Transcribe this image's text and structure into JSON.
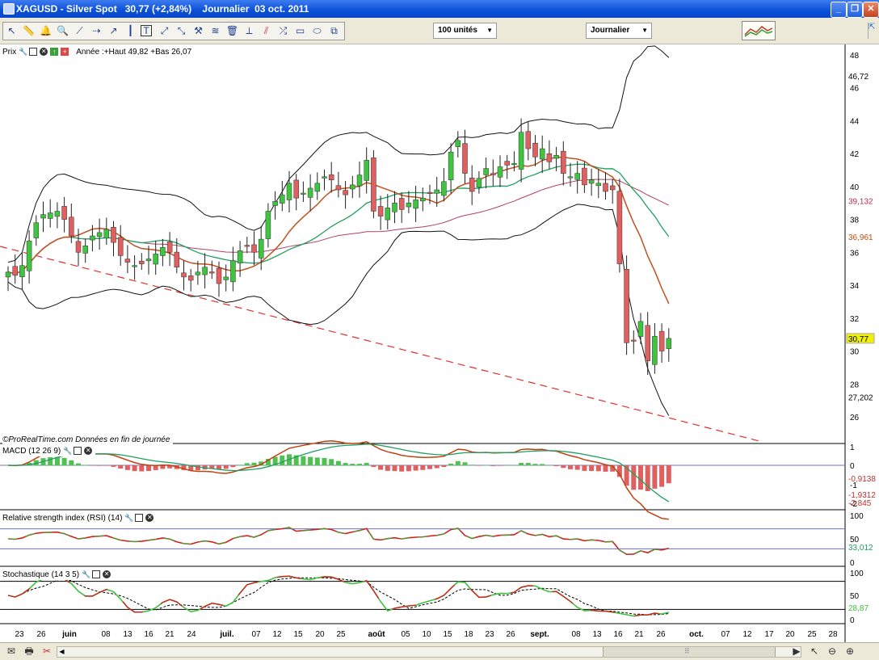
{
  "window": {
    "title": "XAGUSD - Silver Spot   30,77 (+2,84%)    Journalier  03 oct. 2011",
    "minimize_glyph": "_",
    "restore_glyph": "❐",
    "close_glyph": "✕"
  },
  "toolbar": {
    "tools": [
      {
        "name": "pointer-icon",
        "glyph": "↖"
      },
      {
        "name": "ruler-icon",
        "glyph": "📏"
      },
      {
        "name": "alarm-icon",
        "glyph": "🔔"
      },
      {
        "name": "zoom-icon",
        "glyph": "🔍"
      },
      {
        "name": "line-icon",
        "glyph": "⟋"
      },
      {
        "name": "hline-icon",
        "glyph": "⇢"
      },
      {
        "name": "trendline-icon",
        "glyph": "↗"
      },
      {
        "name": "vline-icon",
        "glyph": "┃"
      },
      {
        "name": "text-icon",
        "glyph": "T"
      },
      {
        "name": "arrows-icon",
        "glyph": "⤢"
      },
      {
        "name": "cross-icon",
        "glyph": "⤡"
      },
      {
        "name": "tools-icon",
        "glyph": "⚒"
      },
      {
        "name": "fibo-icon",
        "glyph": "≋"
      },
      {
        "name": "trash-icon",
        "glyph": "🗑"
      },
      {
        "name": "fan-icon",
        "glyph": "⟂"
      },
      {
        "name": "pattern-icon",
        "glyph": "⫽"
      },
      {
        "name": "channel-icon",
        "glyph": "⤮"
      },
      {
        "name": "rectangle-icon",
        "glyph": "▭"
      },
      {
        "name": "ellipse-icon",
        "glyph": "⬭"
      },
      {
        "name": "copy-icon",
        "glyph": "⧉"
      }
    ],
    "units_select": "100 unités",
    "period_select": "Journalier",
    "dropdown_arrow": "▼"
  },
  "price_panel": {
    "label": "Prix",
    "info": "Année :+Haut 49,82 +Bas 26,07",
    "y_ticks": [
      "48",
      "46",
      "44",
      "42",
      "40",
      "38",
      "36",
      "34",
      "32",
      "30",
      "28",
      "26"
    ],
    "markers": [
      {
        "text": "46,72",
        "color": "#000000",
        "bg": "#ffffff"
      },
      {
        "text": "39,132",
        "color": "#b03050",
        "bg": "#ffffff"
      },
      {
        "text": "36,961",
        "color": "#c05010",
        "bg": "#ffffff"
      },
      {
        "text": "30,77",
        "color": "#000000",
        "bg": "#f0f000"
      },
      {
        "text": "27,202",
        "color": "#000000",
        "bg": "#ffffff"
      }
    ],
    "footer": "©ProRealTime.com  Données en fin de journée"
  },
  "macd_panel": {
    "label": "MACD (12 26 9)",
    "y_ticks": [
      "1",
      "0",
      "-1",
      "-2"
    ],
    "markers": [
      {
        "text": "-0,9138",
        "color": "#c03030"
      },
      {
        "text": "-1,9312",
        "color": "#c03030"
      },
      {
        "text": "-2,845",
        "color": "#c03030"
      }
    ]
  },
  "rsi_panel": {
    "label": "Relative strength index (RSI) (14)",
    "y_ticks": [
      "100",
      "50",
      "0"
    ],
    "markers": [
      {
        "text": "33,012",
        "color": "#20a060"
      }
    ]
  },
  "stoch_panel": {
    "label": "Stochastique (14 3 5)",
    "y_ticks": [
      "100",
      "50",
      "0"
    ],
    "markers": [
      {
        "text": "28,87",
        "color": "#40c040"
      }
    ]
  },
  "x_axis": {
    "labels": [
      {
        "t": "23",
        "b": false
      },
      {
        "t": "26",
        "b": false
      },
      {
        "t": "juin",
        "b": true
      },
      {
        "t": "08",
        "b": false
      },
      {
        "t": "13",
        "b": false
      },
      {
        "t": "16",
        "b": false
      },
      {
        "t": "21",
        "b": false
      },
      {
        "t": "24",
        "b": false
      },
      {
        "t": "juil.",
        "b": true
      },
      {
        "t": "07",
        "b": false
      },
      {
        "t": "12",
        "b": false
      },
      {
        "t": "15",
        "b": false
      },
      {
        "t": "20",
        "b": false
      },
      {
        "t": "25",
        "b": false
      },
      {
        "t": "août",
        "b": true
      },
      {
        "t": "05",
        "b": false
      },
      {
        "t": "10",
        "b": false
      },
      {
        "t": "15",
        "b": false
      },
      {
        "t": "18",
        "b": false
      },
      {
        "t": "23",
        "b": false
      },
      {
        "t": "26",
        "b": false
      },
      {
        "t": "sept.",
        "b": true
      },
      {
        "t": "08",
        "b": false
      },
      {
        "t": "13",
        "b": false
      },
      {
        "t": "16",
        "b": false
      },
      {
        "t": "21",
        "b": false
      },
      {
        "t": "26",
        "b": false
      },
      {
        "t": "oct.",
        "b": true
      },
      {
        "t": "07",
        "b": false
      },
      {
        "t": "12",
        "b": false
      },
      {
        "t": "17",
        "b": false
      },
      {
        "t": "20",
        "b": false
      },
      {
        "t": "25",
        "b": false
      },
      {
        "t": "28",
        "b": false
      }
    ]
  },
  "chart_data": {
    "type": "candlestick",
    "ylim": [
      25,
      49
    ],
    "closes": [
      34.8,
      34.6,
      35.2,
      36.7,
      37.8,
      38.3,
      38.4,
      38.5,
      38.0,
      37.0,
      36.0,
      36.4,
      37.0,
      37.2,
      37.4,
      36.6,
      35.8,
      35.4,
      35.2,
      35.3,
      35.6,
      35.9,
      36.3,
      36.0,
      35.1,
      34.5,
      34.3,
      34.8,
      35.1,
      34.8,
      34.1,
      34.5,
      35.5,
      36.1,
      36.4,
      36.0,
      36.8,
      38.5,
      39.1,
      39.5,
      40.2,
      39.3,
      39.6,
      39.9,
      40.2,
      40.6,
      40.4,
      39.8,
      39.5,
      40.1,
      40.7,
      41.6,
      38.5,
      38.2,
      38.7,
      39.0,
      38.6,
      39.0,
      39.2,
      39.3,
      39.6,
      39.8,
      40.3,
      42.1,
      42.8,
      40.8,
      39.7,
      40.5,
      41.1,
      40.7,
      41.2,
      41.3,
      41.4,
      43.3,
      42.3,
      41.8,
      42.3,
      41.5,
      41.9,
      40.8,
      40.6,
      40.8,
      40.1,
      40.4,
      40.2,
      39.7,
      39.8,
      35.3,
      30.5,
      30.6,
      31.8,
      29.4,
      30.9,
      30.0,
      30.77
    ],
    "indicators": [
      "Bollinger Bands (20)",
      "Moving Average (20)",
      "Moving Average (50)",
      "Moving Average (100)"
    ],
    "trendline": "descending dashed support line",
    "macd": {
      "macd": -1.9312,
      "signal": -0.9138,
      "histogram": -2.845
    },
    "rsi": 33.012,
    "stochastic": 28.87,
    "xlabel": "",
    "ylabel": ""
  },
  "statusbar": {
    "icons": [
      {
        "name": "mail-icon",
        "glyph": "✉"
      },
      {
        "name": "print-icon",
        "glyph": "🖶"
      },
      {
        "name": "scissors-icon",
        "glyph": "✂"
      },
      {
        "name": "scroll-right-icon",
        "glyph": "▶"
      },
      {
        "name": "pointer-icon",
        "glyph": "↖"
      },
      {
        "name": "zoom-out-icon",
        "glyph": "⊖"
      },
      {
        "name": "zoom-in-icon",
        "glyph": "⊕"
      }
    ],
    "grip": "⠿",
    "left_arrow": "◀",
    "right_arrow": "▶"
  }
}
